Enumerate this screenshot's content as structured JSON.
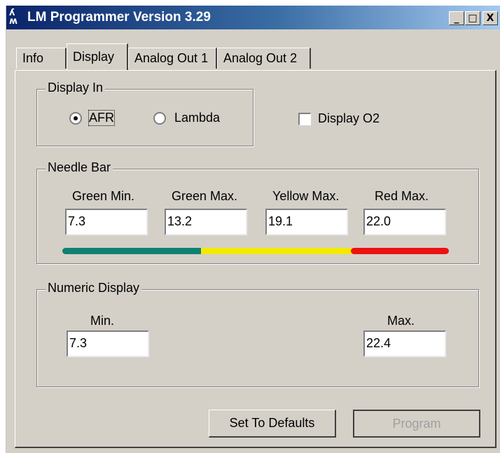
{
  "window": {
    "title": "LM Programmer Version 3.29",
    "controls": {
      "minimize": "_",
      "maximize": "□",
      "close": "X"
    }
  },
  "tabs": [
    {
      "label": "Info",
      "active": false
    },
    {
      "label": "Display",
      "active": true
    },
    {
      "label": "Analog Out 1",
      "active": false
    },
    {
      "label": "Analog Out 2",
      "active": false
    }
  ],
  "display_in": {
    "legend": "Display In",
    "options": [
      {
        "label": "AFR",
        "checked": true
      },
      {
        "label": "Lambda",
        "checked": false
      }
    ]
  },
  "display_o2": {
    "label": "Display O2",
    "checked": false
  },
  "needle_bar": {
    "legend": "Needle Bar",
    "fields": [
      {
        "label": "Green Min.",
        "value": "7.3"
      },
      {
        "label": "Green Max.",
        "value": "13.2"
      },
      {
        "label": "Yellow Max.",
        "value": "19.1"
      },
      {
        "label": "Red Max.",
        "value": "22.0"
      }
    ],
    "colors": {
      "green": "#0e8074",
      "yellow": "#f2ea00",
      "red": "#ee1111"
    }
  },
  "numeric_display": {
    "legend": "Numeric Display",
    "min": {
      "label": "Min.",
      "value": "7.3"
    },
    "max": {
      "label": "Max.",
      "value": "22.4"
    }
  },
  "buttons": {
    "defaults": "Set To Defaults",
    "program": "Program"
  }
}
